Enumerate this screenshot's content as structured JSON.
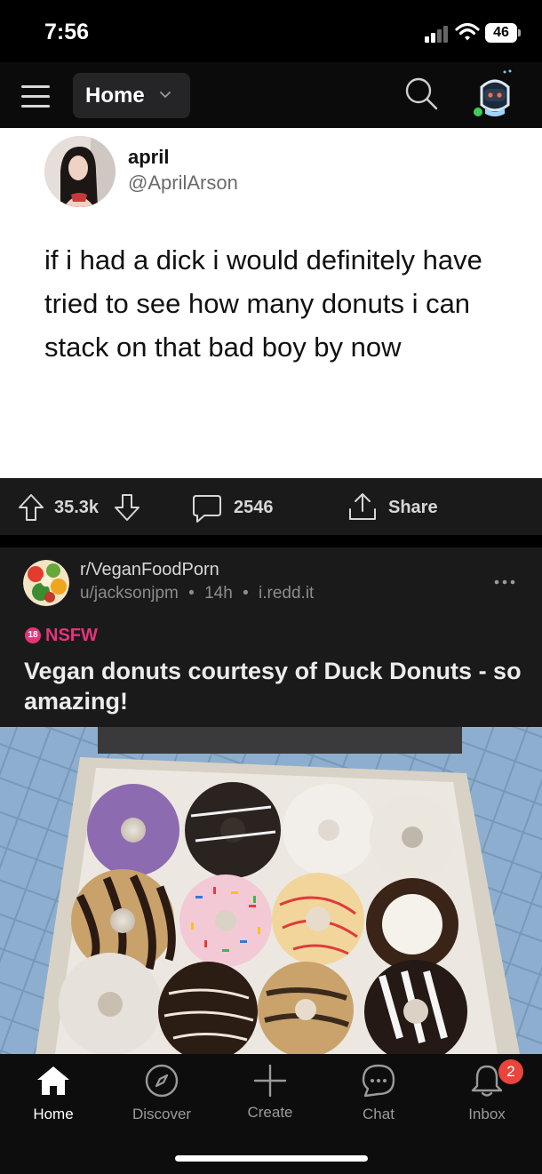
{
  "status_bar": {
    "time": "7:56",
    "battery": "46"
  },
  "header": {
    "feed_label": "Home"
  },
  "tweet": {
    "name": "april",
    "handle": "@AprilArson",
    "lines": [
      "if i had a dick i would definitely have",
      "tried to see how many donuts i can",
      "stack on that bad boy by now"
    ]
  },
  "actions": {
    "upvotes": "35.3k",
    "comments": "2546",
    "share": "Share"
  },
  "post": {
    "subreddit": "r/VeganFoodPorn",
    "user": "u/jacksonjpm",
    "age": "14h",
    "domain": "i.redd.it",
    "nsfw_icon": "18",
    "nsfw": "NSFW",
    "title": "Vegan donuts courtesy of Duck Donuts - so amazing!"
  },
  "bottom_nav": {
    "items": [
      {
        "label": "Home",
        "icon": "home-icon"
      },
      {
        "label": "Discover",
        "icon": "compass-icon"
      },
      {
        "label": "Create",
        "icon": "plus-icon"
      },
      {
        "label": "Chat",
        "icon": "chat-bubble-icon"
      },
      {
        "label": "Inbox",
        "icon": "bell-icon"
      }
    ],
    "inbox_badge": "2"
  }
}
